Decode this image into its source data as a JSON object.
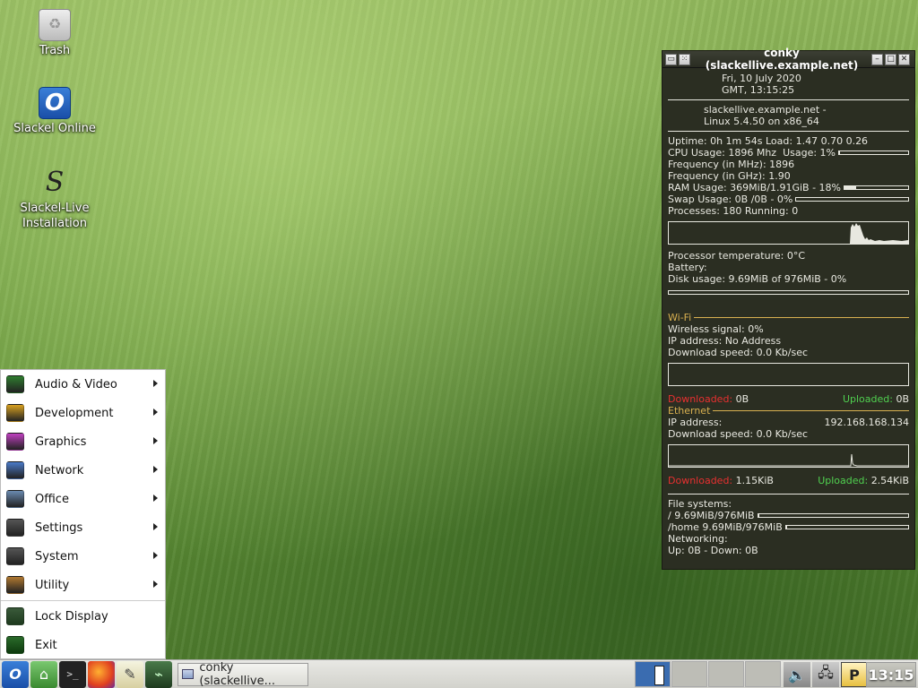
{
  "desktop": {
    "icons": [
      {
        "label": "Trash",
        "icon": "trash-icon"
      },
      {
        "label": "Slackel Online",
        "icon": "slackel-online-icon"
      },
      {
        "label": "Slackel-Live Installation",
        "icon": "slackel-installer-icon"
      }
    ]
  },
  "conky": {
    "window_title": "conky (slackellive.example.net)",
    "date_line": "Fri,   10 July 2020",
    "time_line": "GMT,     13:15:25",
    "host_line": "slackellive.example.net -",
    "kernel_line": "Linux 5.4.50 on x86_64",
    "uptime": "Uptime: 0h 1m 54s",
    "load": "Load: 1.47 0.70 0.26",
    "cpu_usage": "CPU Usage:  1896 Mhz",
    "cpu_usage_pct_label": "Usage:  1%",
    "cpu_usage_pct": 1,
    "freq_mhz": "Frequency (in MHz): 1896",
    "freq_ghz": "Frequency (in GHz): 1.90",
    "ram": "RAM Usage:  369MiB/1.91GiB - 18%",
    "ram_pct": 18,
    "swap": "Swap Usage: 0B  /0B   - 0%",
    "swap_pct": 0,
    "processes": "Processes: 180  Running: 0",
    "proc_temp": "Processor temperature: 0°C",
    "battery": "Battery:",
    "disk": "Disk usage: 9.69MiB of 976MiB - 0%",
    "disk_pct": 0,
    "wifi_header": "Wi-Fi",
    "wifi_signal": "Wireless signal: 0%",
    "wifi_ip": "IP address: No Address",
    "wifi_dl_speed": "Download speed: 0.0 Kb/sec",
    "wifi_downloaded_label": "Downloaded:",
    "wifi_downloaded_val": "0B",
    "wifi_uploaded_label": "Uploaded:",
    "wifi_uploaded_val": "0B",
    "eth_header": "Ethernet",
    "eth_ip_label": "IP address:",
    "eth_ip_val": "192.168.168.134",
    "eth_dl_speed": "Download speed: 0.0 Kb/sec",
    "eth_downloaded_label": "Downloaded:",
    "eth_downloaded_val": "1.15KiB",
    "eth_uploaded_label": "Uploaded:",
    "eth_uploaded_val": "2.54KiB",
    "fs_header": "File systems:",
    "fs_root": " / 9.69MiB/976MiB",
    "fs_root_pct": 1,
    "fs_home": " /home 9.69MiB/976MiB",
    "fs_home_pct": 1,
    "net_header": "Networking:",
    "net_line": " Up: 0B    - Down: 0B"
  },
  "menu": {
    "items": [
      {
        "label": "Audio & Video",
        "icon": "audio-video-icon",
        "color": "#2f7d2f"
      },
      {
        "label": "Development",
        "icon": "development-icon",
        "color": "#d8a020"
      },
      {
        "label": "Graphics",
        "icon": "graphics-icon",
        "color": "#c040c0"
      },
      {
        "label": "Network",
        "icon": "network-icon",
        "color": "#4a7ac8"
      },
      {
        "label": "Office",
        "icon": "office-icon",
        "color": "#6a8ab0"
      },
      {
        "label": "Settings",
        "icon": "settings-icon",
        "color": "#555555"
      },
      {
        "label": "System",
        "icon": "system-icon",
        "color": "#555555"
      },
      {
        "label": "Utility",
        "icon": "utility-icon",
        "color": "#b07830"
      }
    ],
    "lock_label": "Lock Display",
    "exit_label": "Exit"
  },
  "taskbar": {
    "task_label": "conky (slackellive...",
    "clock": "13:15",
    "active_workspace": 1
  }
}
